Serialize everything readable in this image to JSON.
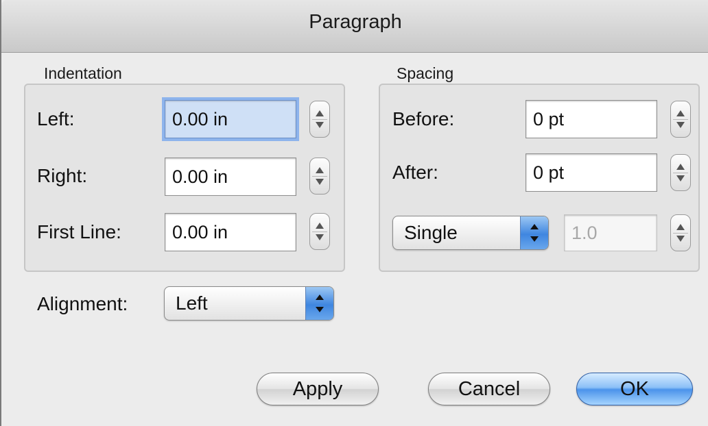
{
  "window": {
    "title": "Paragraph"
  },
  "indentation": {
    "label": "Indentation",
    "left": {
      "label": "Left:",
      "value": "0.00 in"
    },
    "right": {
      "label": "Right:",
      "value": "0.00 in"
    },
    "first_line": {
      "label": "First Line:",
      "value": "0.00 in"
    }
  },
  "spacing": {
    "label": "Spacing",
    "before": {
      "label": "Before:",
      "value": "0 pt"
    },
    "after": {
      "label": "After:",
      "value": "0 pt"
    },
    "line_spacing": {
      "selected": "Single",
      "value": "1.0"
    }
  },
  "alignment": {
    "label": "Alignment:",
    "selected": "Left"
  },
  "buttons": {
    "apply": "Apply",
    "cancel": "Cancel",
    "ok": "OK"
  },
  "colors": {
    "focus_ring": "#8eb4ec",
    "popup_accent": "#3f86e0",
    "default_button": "#4b93ea"
  },
  "icons": {
    "stepper": "up-down-stepper-icon",
    "popup": "popup-arrows-icon"
  }
}
